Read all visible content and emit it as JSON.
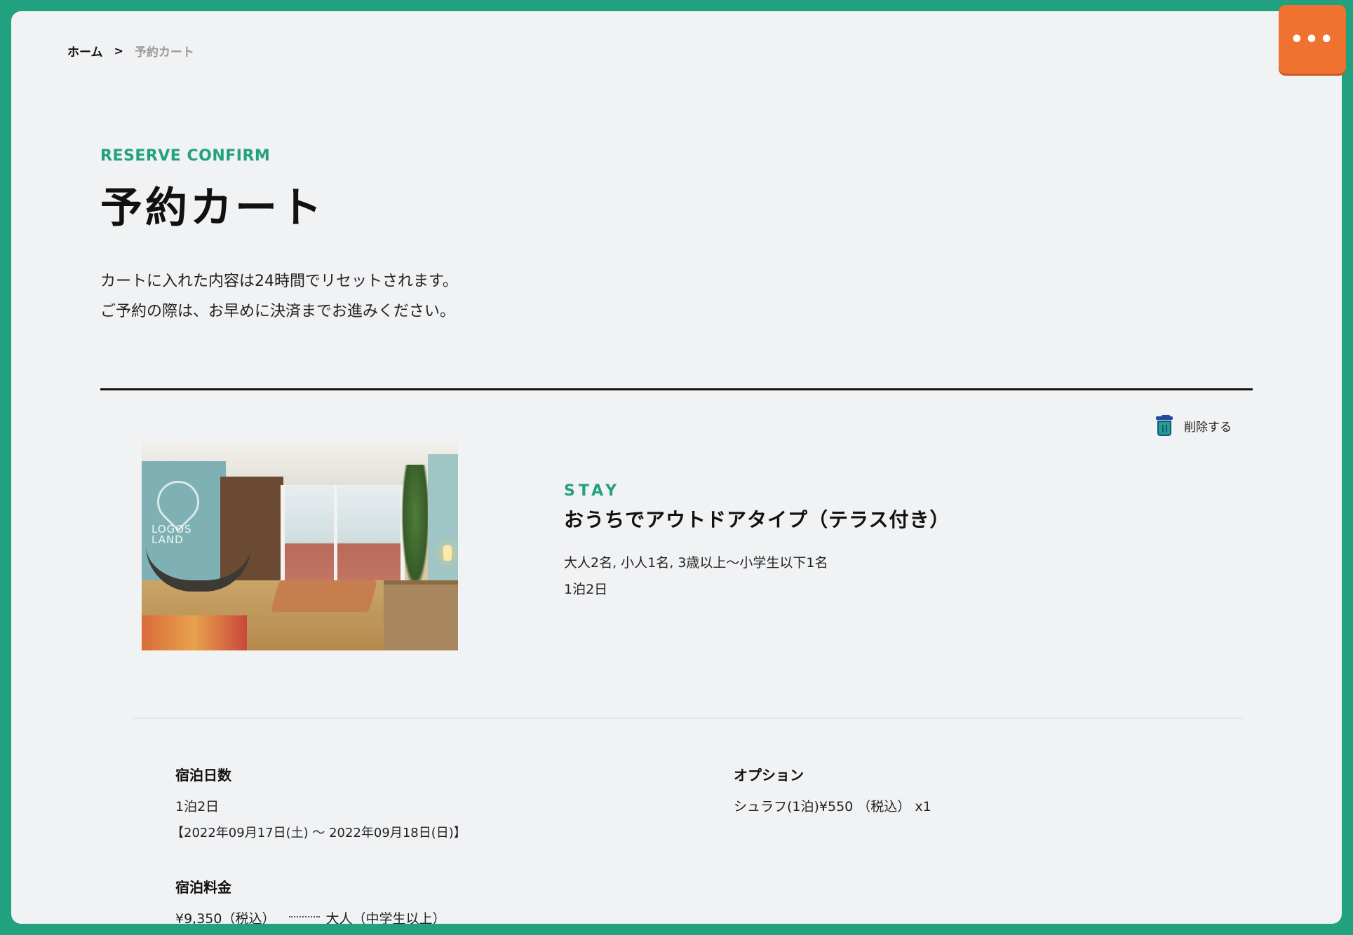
{
  "breadcrumb": {
    "home": "ホーム",
    "separator": ">",
    "current": "予約カート"
  },
  "menu_button": {
    "label": "•••"
  },
  "header": {
    "subtitle": "RESERVE CONFIRM",
    "title": "予約カート"
  },
  "notice": {
    "line1": "カートに入れた内容は24時間でリセットされます。",
    "line2": "ご予約の際は、お早めに決済までお進みください。"
  },
  "cart_item": {
    "delete_label": "削除する",
    "photo_logo_line1": "LOGOS",
    "photo_logo_line2": "LAND",
    "category": "STAY",
    "room_name": "おうちでアウトドアタイプ（テラス付き）",
    "guests": "大人2名, 小人1名, 3歳以上〜小学生以下1名",
    "nights": "1泊2日"
  },
  "details": {
    "stay_length": {
      "label": "宿泊日数",
      "value": "1泊2日",
      "dates": "【2022年09月17日(土) 〜 2022年09月18日(日)】"
    },
    "options": {
      "label": "オプション",
      "value": "シュラフ(1泊)¥550 （税込） x1"
    },
    "stay_price": {
      "label": "宿泊料金",
      "amount": "¥9,350（税込）",
      "category": "大人（中学生以上）"
    }
  },
  "colors": {
    "frame": "#21a17e",
    "accent": "#21a17e",
    "menu": "#f07230",
    "panel": "#f1f2f4"
  }
}
